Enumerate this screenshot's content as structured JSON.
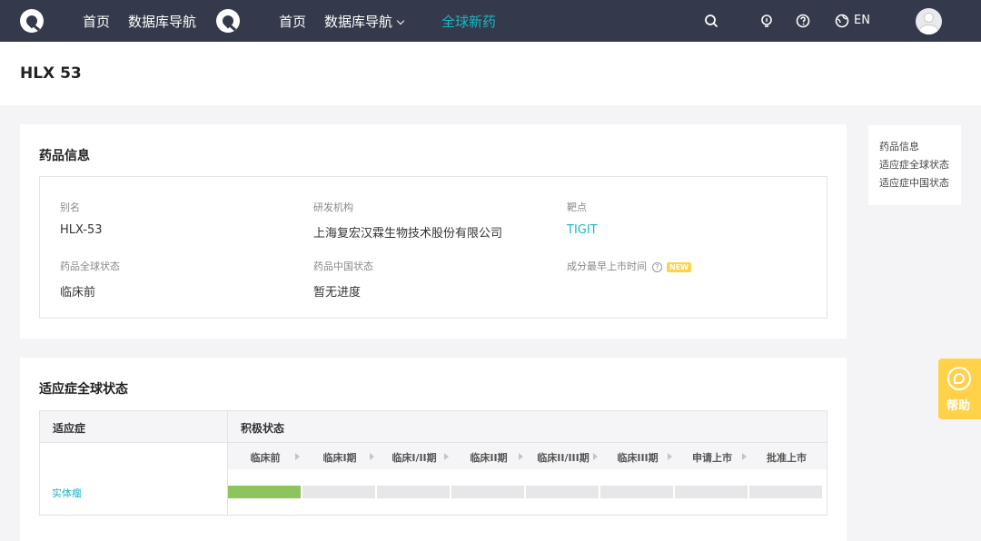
{
  "nav": {
    "items": [
      {
        "label": "首页"
      },
      {
        "label": "数据库导航"
      },
      {
        "label": "首页"
      },
      {
        "label": "数据库导航"
      },
      {
        "label": "全球新药"
      }
    ],
    "lang": "EN"
  },
  "page": {
    "title": "HLX 53"
  },
  "drug_info": {
    "heading": "药品信息",
    "alias_label": "别名",
    "alias_value": "HLX-53",
    "org_label": "研发机构",
    "org_value": "上海复宏汉霖生物技术股份有限公司",
    "target_label": "靶点",
    "target_value": "TIGIT",
    "global_status_label": "药品全球状态",
    "global_status_value": "临床前",
    "china_status_label": "药品中国状态",
    "china_status_value": "暂无进度",
    "earliest_label": "成分最早上市时间",
    "new_badge": "NEW"
  },
  "indication": {
    "heading": "适应症全球状态",
    "col_indication": "适应症",
    "col_status": "积极状态",
    "stages": [
      "临床前",
      "临床I期",
      "临床I/II期",
      "临床II期",
      "临床II/III期",
      "临床III期",
      "申请上市",
      "批准上市"
    ],
    "rows": [
      {
        "name": "实体瘤",
        "completed_stages": 1
      }
    ]
  },
  "anchors": [
    "药品信息",
    "适应症全球状态",
    "适应症中国状态"
  ],
  "help": {
    "label": "帮助"
  },
  "colors": {
    "nav_bg": "#343a4b",
    "accent": "#1ab6c5",
    "progress": "#8cc45e",
    "help_bg": "#ffd24a"
  }
}
